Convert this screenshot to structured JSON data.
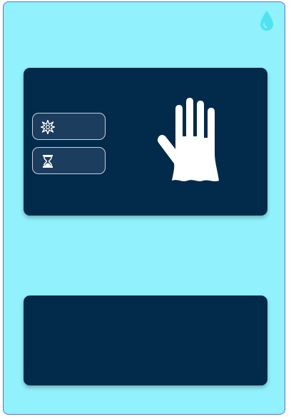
{
  "icons": {
    "top_right": "water-drop-icon",
    "hand": "glove-hand-icon",
    "button_1": "sparkle-burst-icon",
    "button_2": "hourglass-icon"
  },
  "colors": {
    "background": "#91f1fc",
    "border": "#5b6fd6",
    "card": "#022a4a",
    "pill": "#1c3d5e",
    "drop": "#4fe3f0",
    "icon": "#ffffff"
  }
}
